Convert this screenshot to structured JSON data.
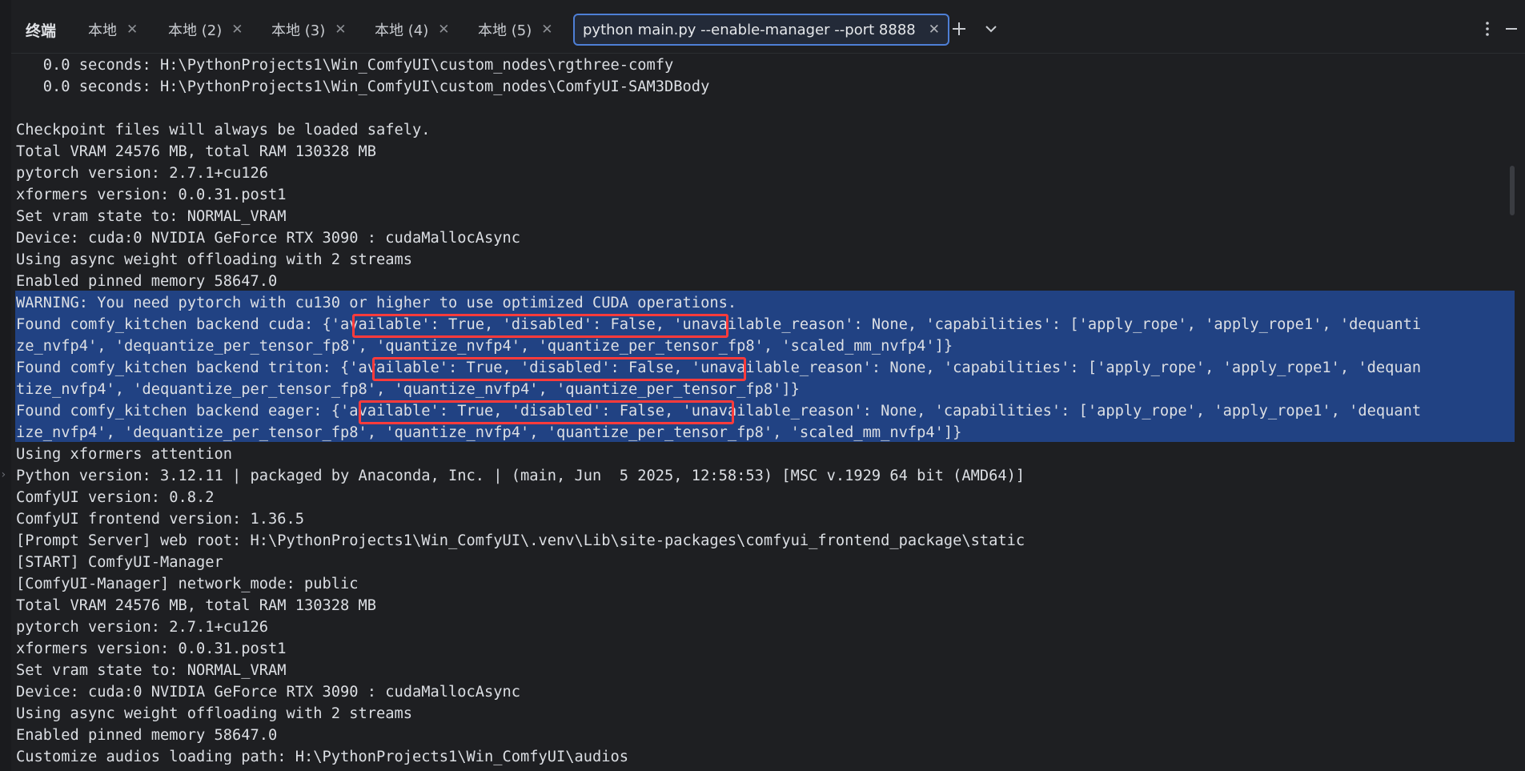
{
  "header": {
    "title": "终端",
    "tabs": [
      {
        "label": "本地",
        "active": false
      },
      {
        "label": "本地 (2)",
        "active": false
      },
      {
        "label": "本地 (3)",
        "active": false
      },
      {
        "label": "本地 (4)",
        "active": false
      },
      {
        "label": "本地 (5)",
        "active": false
      },
      {
        "label": "python main.py --enable-manager --port 8888",
        "active": true
      }
    ]
  },
  "terminal": {
    "lines": [
      "   0.0 seconds: H:\\PythonProjects1\\Win_ComfyUI\\custom_nodes\\rgthree-comfy",
      "   0.0 seconds: H:\\PythonProjects1\\Win_ComfyUI\\custom_nodes\\ComfyUI-SAM3DBody",
      "",
      "Checkpoint files will always be loaded safely.",
      "Total VRAM 24576 MB, total RAM 130328 MB",
      "pytorch version: 2.7.1+cu126",
      "xformers version: 0.0.31.post1",
      "Set vram state to: NORMAL_VRAM",
      "Device: cuda:0 NVIDIA GeForce RTX 3090 : cudaMallocAsync",
      "Using async weight offloading with 2 streams",
      "Enabled pinned memory 58647.0",
      "WARNING: You need pytorch with cu130 or higher to use optimized CUDA operations.",
      "Found comfy_kitchen backend cuda: {'available': True, 'disabled': False, 'unavailable_reason': None, 'capabilities': ['apply_rope', 'apply_rope1', 'dequanti",
      "ze_nvfp4', 'dequantize_per_tensor_fp8', 'quantize_nvfp4', 'quantize_per_tensor_fp8', 'scaled_mm_nvfp4']}",
      "Found comfy_kitchen backend triton: {'available': True, 'disabled': False, 'unavailable_reason': None, 'capabilities': ['apply_rope', 'apply_rope1', 'dequan",
      "tize_nvfp4', 'dequantize_per_tensor_fp8', 'quantize_nvfp4', 'quantize_per_tensor_fp8']}",
      "Found comfy_kitchen backend eager: {'available': True, 'disabled': False, 'unavailable_reason': None, 'capabilities': ['apply_rope', 'apply_rope1', 'dequant",
      "ize_nvfp4', 'dequantize_per_tensor_fp8', 'quantize_nvfp4', 'quantize_per_tensor_fp8', 'scaled_mm_nvfp4']}",
      "Using xformers attention",
      "Python version: 3.12.11 | packaged by Anaconda, Inc. | (main, Jun  5 2025, 12:58:53) [MSC v.1929 64 bit (AMD64)]",
      "ComfyUI version: 0.8.2",
      "ComfyUI frontend version: 1.36.5",
      "[Prompt Server] web root: H:\\PythonProjects1\\Win_ComfyUI\\.venv\\Lib\\site-packages\\comfyui_frontend_package\\static",
      "[START] ComfyUI-Manager",
      "[ComfyUI-Manager] network_mode: public",
      "Total VRAM 24576 MB, total RAM 130328 MB",
      "pytorch version: 2.7.1+cu126",
      "xformers version: 0.0.31.post1",
      "Set vram state to: NORMAL_VRAM",
      "Device: cuda:0 NVIDIA GeForce RTX 3090 : cudaMallocAsync",
      "Using async weight offloading with 2 streams",
      "Enabled pinned memory 58647.0",
      "Customize audios loading path: H:\\PythonProjects1\\Win_ComfyUI\\audios"
    ]
  }
}
